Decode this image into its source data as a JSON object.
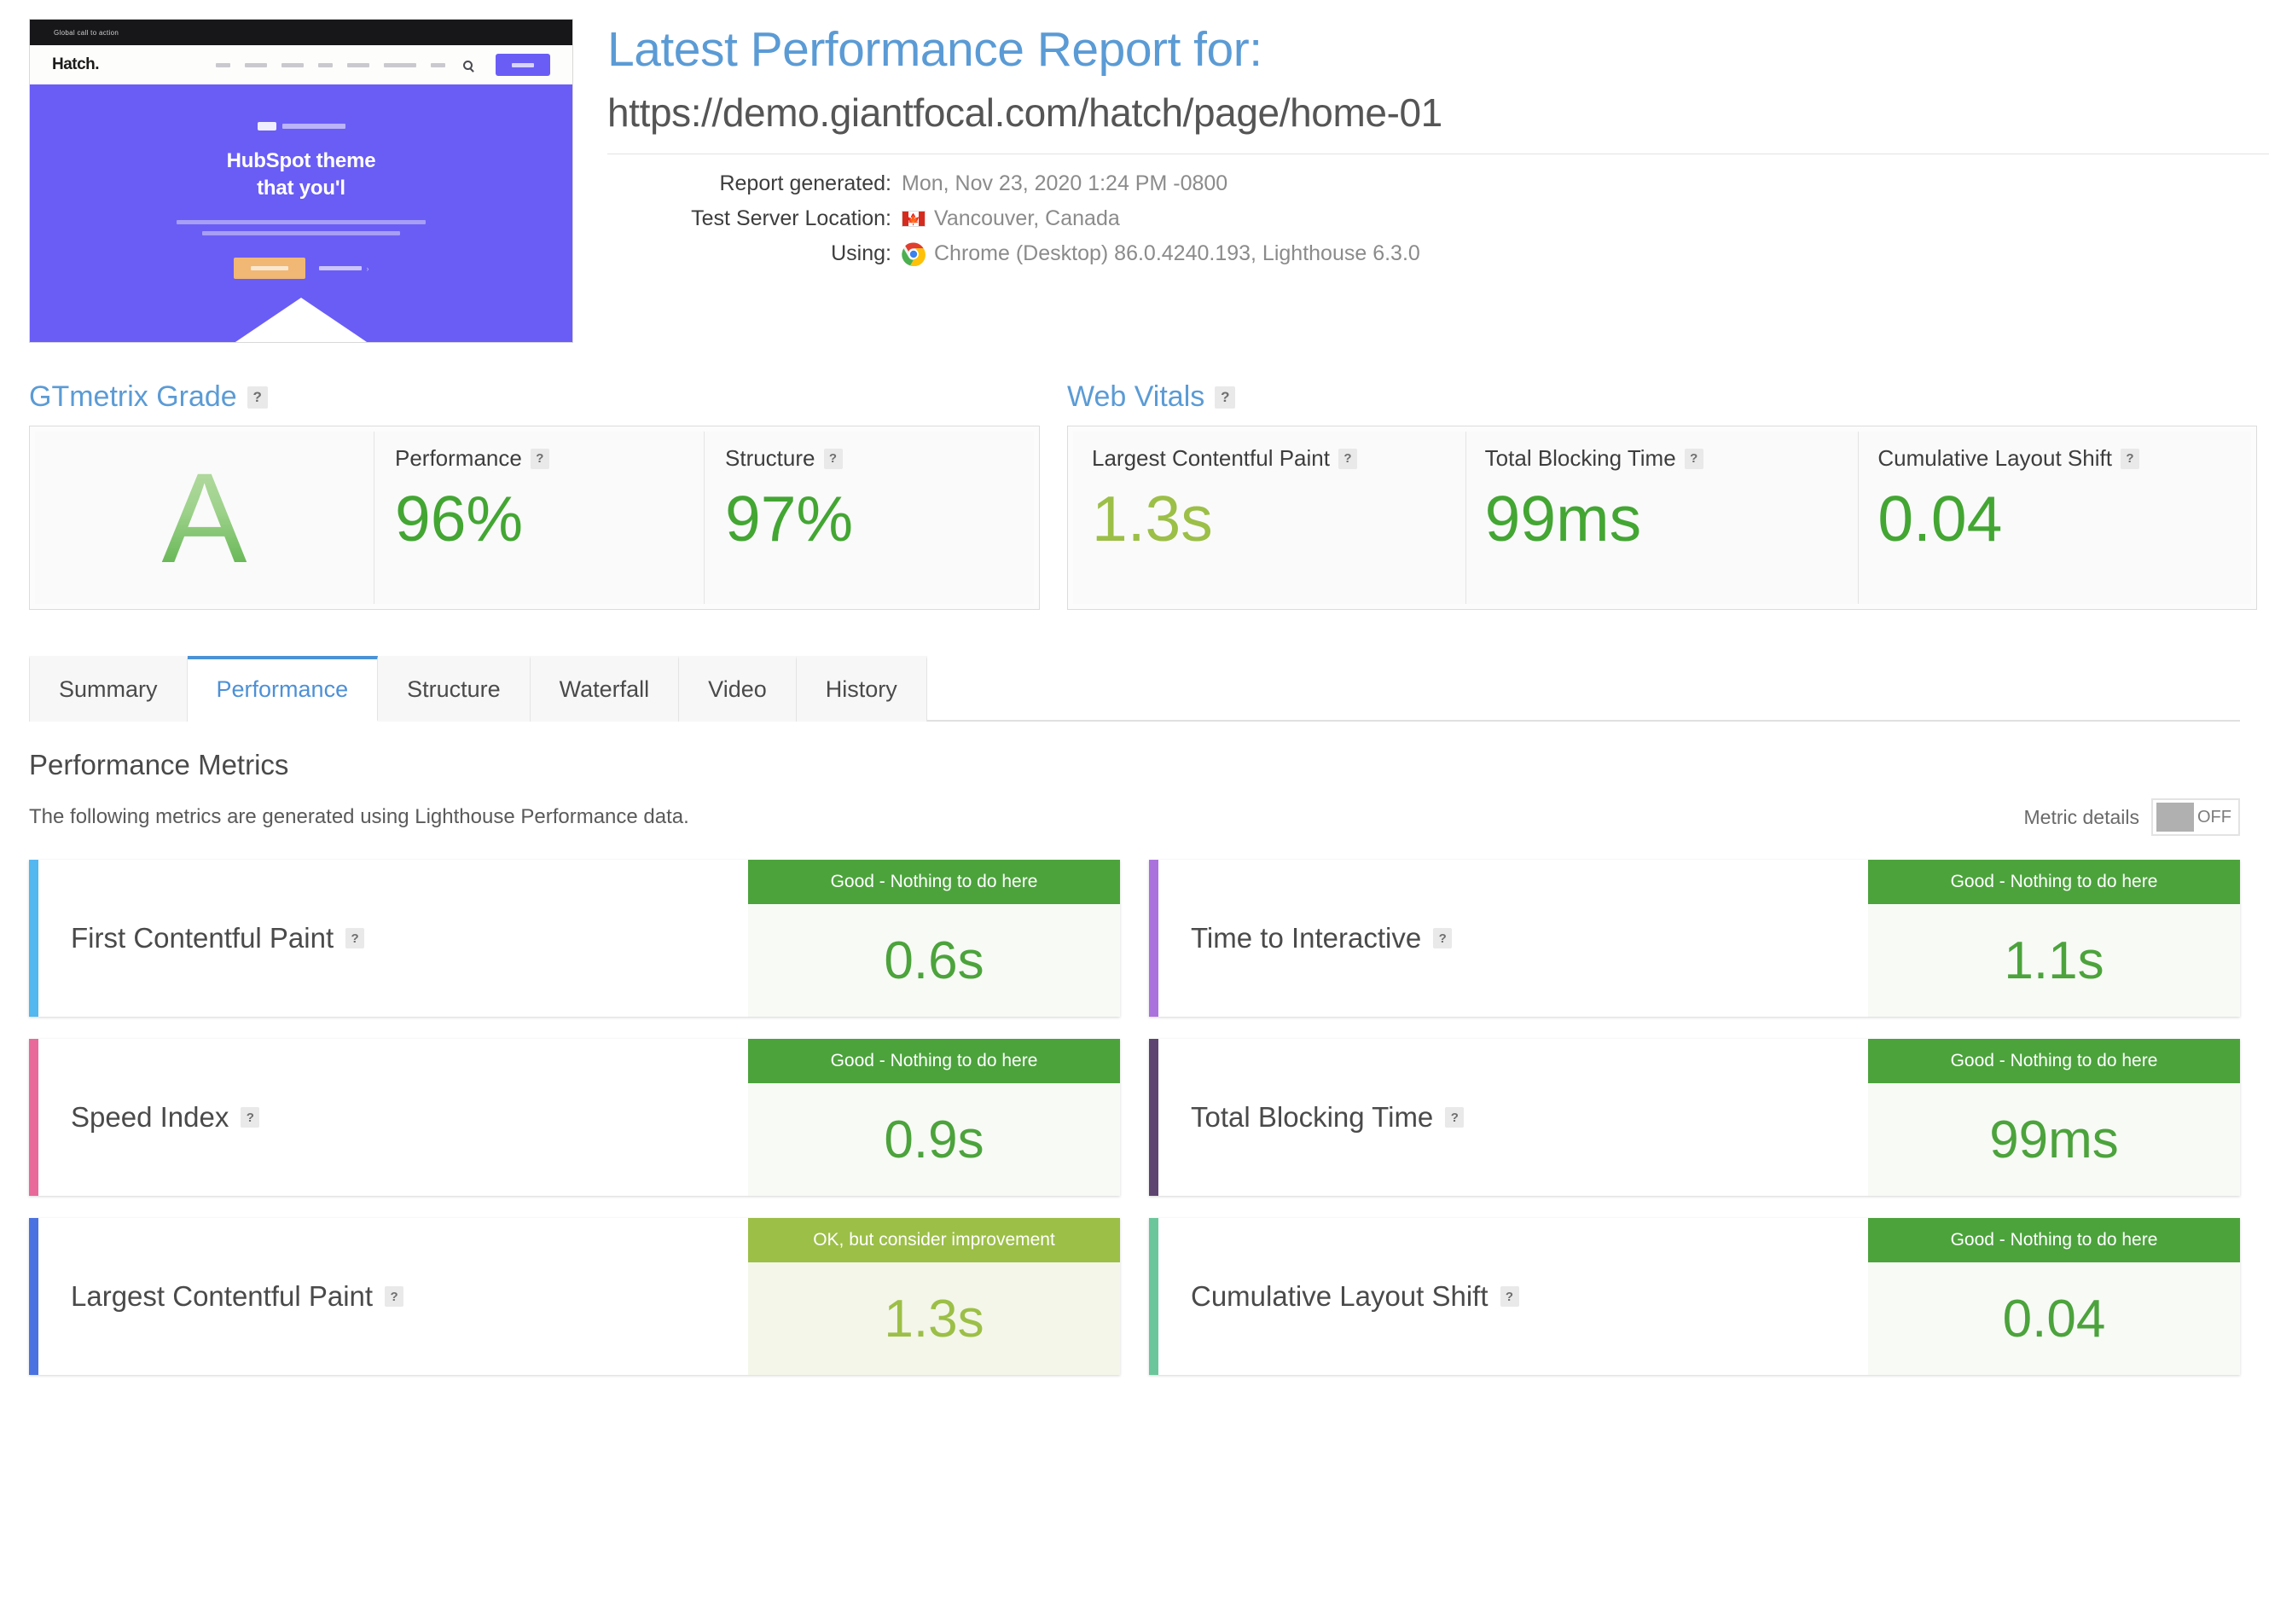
{
  "header": {
    "title": "Latest Performance Report for:",
    "url": "https://demo.giantfocal.com/hatch/page/home-01",
    "meta": [
      {
        "label": "Report generated:",
        "value": "Mon, Nov 23, 2020 1:24 PM -0800",
        "icon": ""
      },
      {
        "label": "Test Server Location:",
        "value": "Vancouver, Canada",
        "icon": "canada-flag-icon"
      },
      {
        "label": "Using:",
        "value": "Chrome (Desktop) 86.0.4240.193, Lighthouse 6.3.0",
        "icon": "chrome-icon"
      }
    ]
  },
  "thumbnail": {
    "topbar_text": "Global call to action",
    "logo": "Hatch.",
    "hero_heading_line1": "HubSpot theme",
    "hero_heading_line2": "that you'l",
    "cta_secondary": "›"
  },
  "gtmetrix_grade": {
    "panel_title": "GTmetrix Grade",
    "help": "?",
    "grade": "A",
    "cells": [
      {
        "label": "Performance",
        "value": "96%"
      },
      {
        "label": "Structure",
        "value": "97%"
      }
    ]
  },
  "web_vitals": {
    "panel_title": "Web Vitals",
    "help": "?",
    "cells": [
      {
        "label": "Largest Contentful Paint",
        "value": "1.3s",
        "tone": "olive"
      },
      {
        "label": "Total Blocking Time",
        "value": "99ms",
        "tone": "good"
      },
      {
        "label": "Cumulative Layout Shift",
        "value": "0.04",
        "tone": "good"
      }
    ]
  },
  "tabs": [
    {
      "label": "Summary",
      "active": false
    },
    {
      "label": "Performance",
      "active": true
    },
    {
      "label": "Structure",
      "active": false
    },
    {
      "label": "Waterfall",
      "active": false
    },
    {
      "label": "Video",
      "active": false
    },
    {
      "label": "History",
      "active": false
    }
  ],
  "metrics_section": {
    "title": "Performance Metrics",
    "description": "The following metrics are generated using Lighthouse Performance data.",
    "toggle_label": "Metric details",
    "toggle_state": "OFF"
  },
  "metrics": [
    {
      "name": "First Contentful Paint",
      "badge": "Good - Nothing to do here",
      "value": "0.6s",
      "tone": "good",
      "accent": "#53b7f0"
    },
    {
      "name": "Time to Interactive",
      "badge": "Good - Nothing to do here",
      "value": "1.1s",
      "tone": "good",
      "accent": "#a972dd"
    },
    {
      "name": "Speed Index",
      "badge": "Good - Nothing to do here",
      "value": "0.9s",
      "tone": "good",
      "accent": "#e8699a"
    },
    {
      "name": "Total Blocking Time",
      "badge": "Good - Nothing to do here",
      "value": "99ms",
      "tone": "good",
      "accent": "#5e4470"
    },
    {
      "name": "Largest Contentful Paint",
      "badge": "OK, but consider improvement",
      "value": "1.3s",
      "tone": "ok",
      "accent": "#4a72e0"
    },
    {
      "name": "Cumulative Layout Shift",
      "badge": "Good - Nothing to do here",
      "value": "0.04",
      "tone": "good",
      "accent": "#6bc79b"
    }
  ],
  "colors": {
    "brand_blue": "#5b9bd5",
    "good_green": "#4ca33c",
    "ok_olive": "#9cbf47",
    "tab_active": "#4a92d6"
  }
}
